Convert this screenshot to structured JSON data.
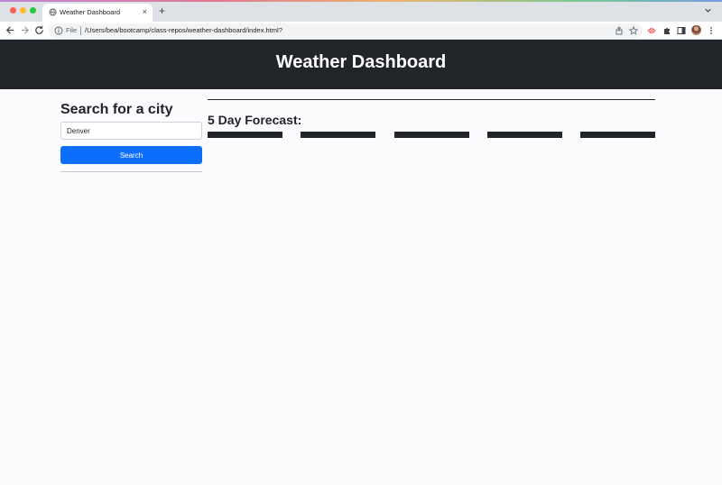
{
  "browser": {
    "tab_title": "Weather Dashboard",
    "tab_close": "×",
    "new_tab": "+",
    "url_scheme": "File",
    "url_path": "/Users/bea/bootcamp/class-repos/weather-dashboard/index.html?",
    "icons": [
      "back-arrow-icon",
      "forward-arrow-icon",
      "reload-icon",
      "info-icon",
      "share-icon",
      "star-icon",
      "extension-icon",
      "puzzle-icon",
      "sidepanel-icon",
      "kebab-menu-icon"
    ]
  },
  "header": {
    "title": "Weather Dashboard"
  },
  "sidebar": {
    "heading": "Search for a city",
    "search_value": "Denver",
    "search_button": "Search"
  },
  "main": {
    "forecast_heading": "5 Day Forecast:",
    "forecast_cards": 5
  },
  "colors": {
    "header_bg": "#212529",
    "button_bg": "#0d6efd",
    "page_bg": "#fcfbfd",
    "card_bg": "#212529"
  }
}
